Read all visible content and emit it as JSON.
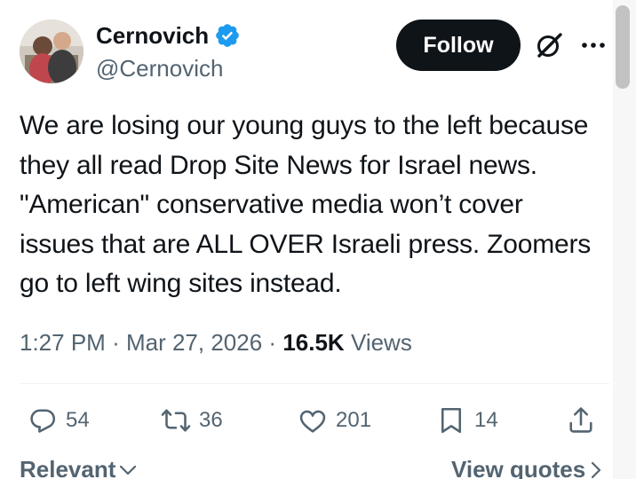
{
  "author": {
    "display_name": "Cernovich",
    "handle": "@Cernovich",
    "verified": true,
    "verified_color": "#1d9bf0",
    "avatar": "avatar-photo"
  },
  "header": {
    "follow_label": "Follow",
    "grok_icon": "grok-icon",
    "more_icon": "more-icon"
  },
  "tweet": {
    "lines": [
      "We are losing our young guys to the left because",
      "they all read Drop Site News for Israel news.",
      "\"American\" conservative media won’t cover",
      "issues that are ALL OVER Israeli press. Zoomers",
      "go to left wing sites instead."
    ]
  },
  "meta": {
    "time": "1:27 PM",
    "separator": "·",
    "date": "Mar 27, 2026",
    "views_count": "16.5K",
    "views_label": "Views"
  },
  "actions": {
    "replies": "54",
    "retweets": "36",
    "likes": "201",
    "bookmarks": "14"
  },
  "footer": {
    "sort_label": "Relevant",
    "view_quotes_label": "View quotes"
  },
  "colors": {
    "text_primary": "#0f1419",
    "text_secondary": "#536471",
    "follow_bg": "#0f1419"
  }
}
